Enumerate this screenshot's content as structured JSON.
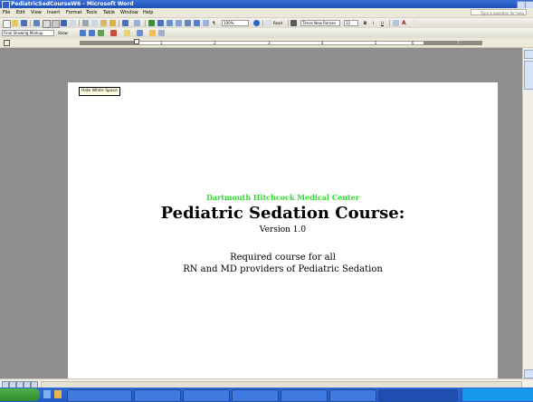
{
  "window": {
    "title": "PediatricSedCourseW6 - Microsoft Word"
  },
  "menu": {
    "items": [
      "File",
      "Edit",
      "View",
      "Insert",
      "Format",
      "Tools",
      "Table",
      "Window",
      "Help"
    ],
    "help_placeholder": "Type a question for help"
  },
  "standard_toolbar": {
    "zoom": "100%",
    "read_label": "Read",
    "font_name": "Times New Roman",
    "font_size": "12",
    "bold_label": "B",
    "italic_label": "I",
    "underline_label": "U"
  },
  "reviewing_toolbar": {
    "markup_mode": "Final Showing Markup",
    "show_label": "Show"
  },
  "ruler": {
    "numbers": [
      "1",
      "2",
      "3",
      "4",
      "5",
      "6",
      "7"
    ]
  },
  "tooltip": "Hide White Space",
  "document": {
    "organization": "Dartmouth Hitchcock Medical Center",
    "title": "Pediatric Sedation Course:",
    "version": "Version 1.0",
    "line1": "Required course for all",
    "line2": "RN and MD providers of Pediatric Sedation"
  },
  "colors": {
    "title_bar": "#2457c6",
    "workspace": "#8e8e8e",
    "organization_text": "#2ee02e",
    "taskbar": "#2a60cf"
  }
}
